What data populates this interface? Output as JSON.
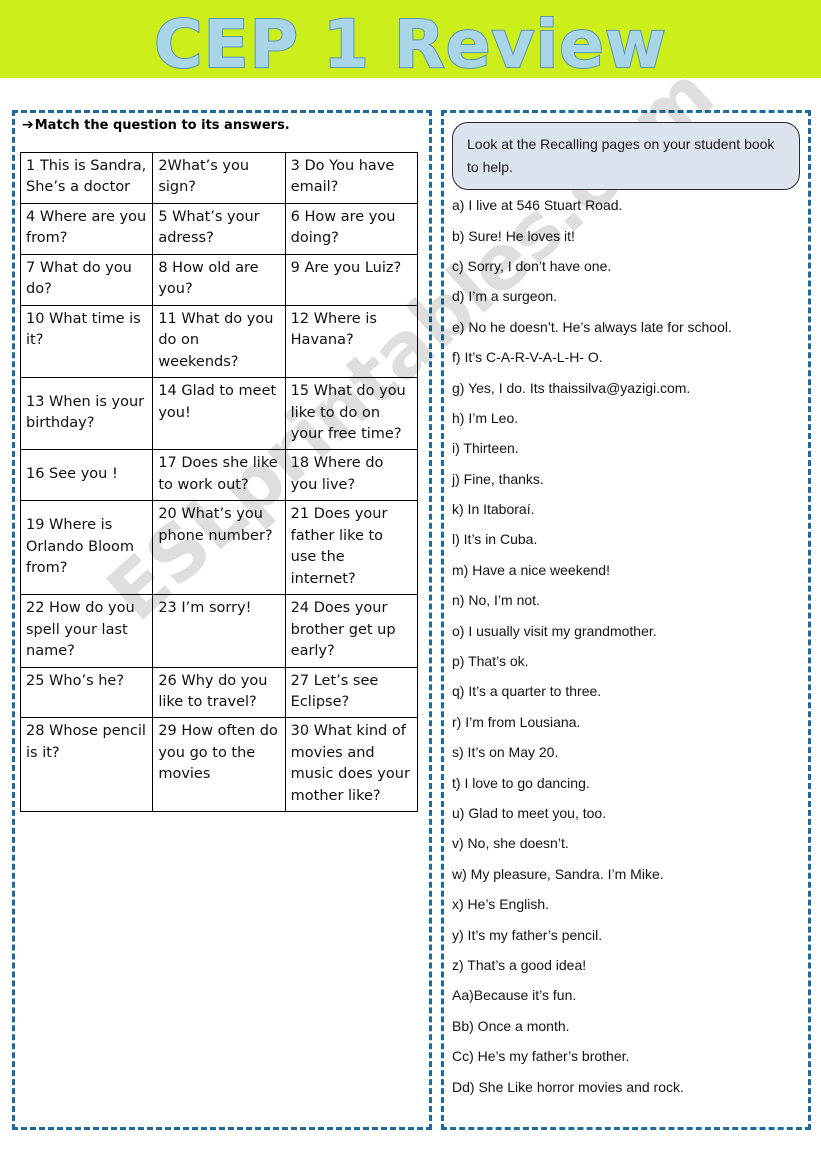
{
  "header": {
    "title": "CEP 1 Review",
    "band_color": "#ccee1a",
    "title_fill_color": "#a8d5e8",
    "title_outline_color": "#5b95b5"
  },
  "watermark": {
    "text": "ESLprintables.com"
  },
  "left_panel": {
    "instruction_arrow": "➔",
    "instruction": "Match the question to its answers.",
    "questions_table": {
      "rows": [
        [
          "1 This is Sandra, She’s a doctor",
          "2What’s you sign?",
          "3 Do You have email?"
        ],
        [
          "4\nWhere are you from?",
          "5 What’s your adress?",
          "6 How are you doing?"
        ],
        [
          "7\nWhat do you do?",
          "8\nHow old are you?",
          "9\nAre you Luiz?"
        ],
        [
          "10 What time is it?",
          "11 What do you do on weekends?",
          "12 Where is Havana?"
        ],
        [
          "13 When is your birthday?",
          "14\nGlad to meet you!",
          "15 What do you like to do on your free time?"
        ],
        [
          "16 See you !",
          "17\nDoes she like to work out?",
          "18\nWhere do you live?"
        ],
        [
          "19 Where is Orlando Bloom from?",
          "20    What’s you phone number?",
          "21 Does your father like to use the internet?"
        ],
        [
          "22\nHow do you spell your last name?",
          "23\nI’m sorry!",
          "24 Does your brother get up early?"
        ],
        [
          "25 Who’s he?",
          "26 Why do you like to travel?",
          "27 Let’s see Eclipse?"
        ],
        [
          "28 Whose pencil is it?",
          "29 How often do you go to the movies",
          "30 What kind of movies and music does your mother like?"
        ]
      ]
    }
  },
  "right_panel": {
    "tip": "Look at the Recalling pages on your student book to help.",
    "tip_bg_color": "#dce3ef",
    "answers": [
      "a)  I live at 546 Stuart Road.",
      "b)  Sure! He loves it!",
      "c) Sorry, I don’t have one.",
      "d) I’m a surgeon.",
      "e) No he doesn’t. He’s always late for school.",
      "f) It’s C-A-R-V-A-L-H- O.",
      "g) Yes, I do. Its thaissilva@yazigi.com.",
      "h) I’m Leo.",
      "i) Thirteen.",
      "j) Fine, thanks.",
      "k) In Itaboraí.",
      "l) It’s in Cuba.",
      "m) Have a nice weekend!",
      "n) No, I’m not.",
      "o) I usually visit my grandmother.",
      "p) That’s ok.",
      "q) It’s a quarter to three.",
      "r) I’m from Lousiana.",
      "s) It’s on May 20.",
      "t) I love to go dancing.",
      "u) Glad to meet you, too.",
      "v) No, she doesn’t.",
      "w) My pleasure, Sandra. I’m Mike.",
      "x) He’s English.",
      "y) It’s my father’s pencil.",
      "z) That’s a good idea!",
      "Aa)Because it’s fun.",
      "Bb) Once a month.",
      "Cc) He’s my father’s brother.",
      "Dd) She Like horror movies and rock."
    ]
  }
}
